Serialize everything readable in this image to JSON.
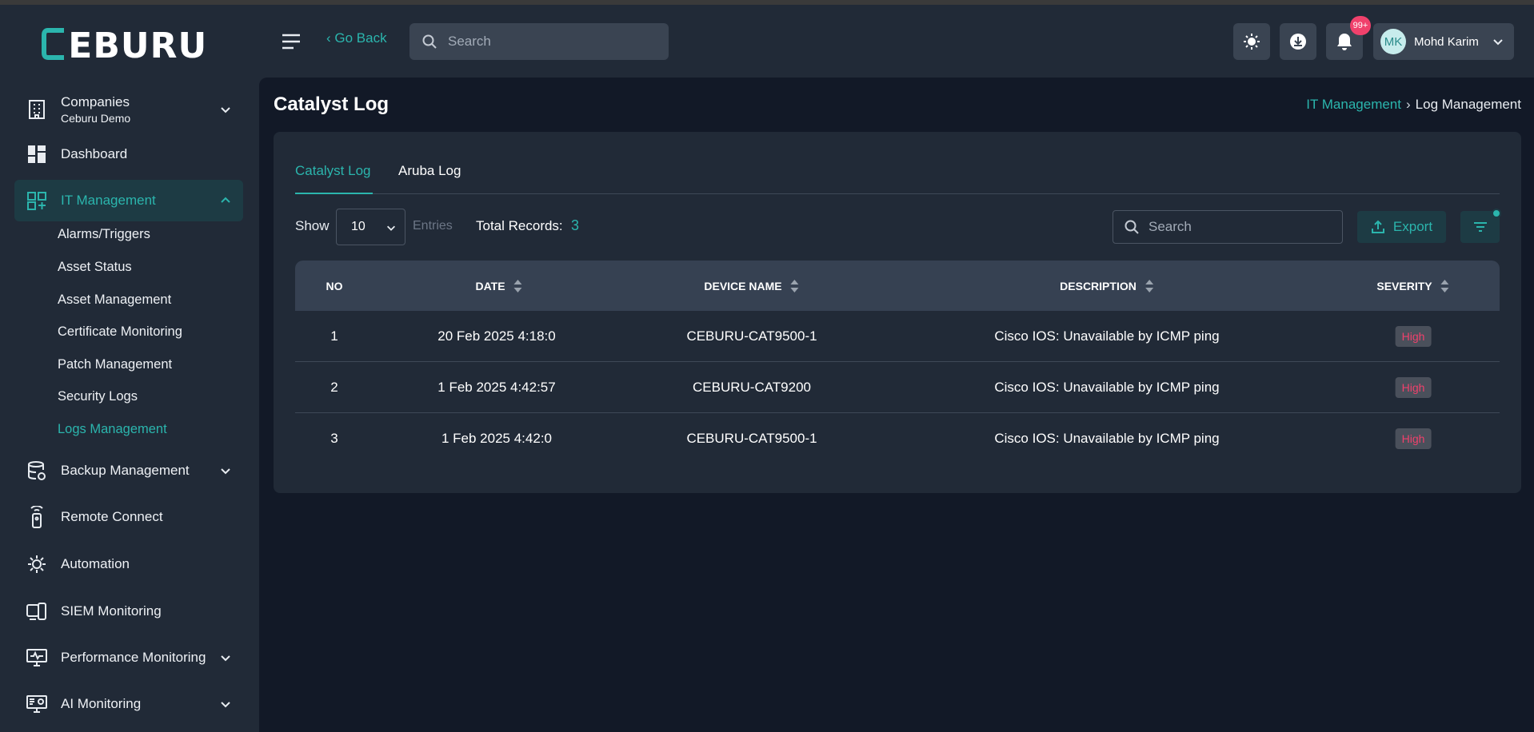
{
  "app": {
    "logo_text": "CEBURU",
    "go_back": "Go Back",
    "search_placeholder": "Search",
    "notification_badge": "99+",
    "user": {
      "initials": "MK",
      "name": "Mohd Karim"
    }
  },
  "sidebar": {
    "companies": {
      "label": "Companies",
      "sub": "Ceburu Demo"
    },
    "items": [
      {
        "label": "Dashboard",
        "icon": "dashboard-icon"
      },
      {
        "label": "IT Management",
        "icon": "it-management-icon",
        "active": true
      },
      {
        "label": "Backup Management",
        "icon": "database-icon"
      },
      {
        "label": "Remote Connect",
        "icon": "remote-icon"
      },
      {
        "label": "Automation",
        "icon": "automation-icon"
      },
      {
        "label": "SIEM Monitoring",
        "icon": "siem-icon"
      },
      {
        "label": "Performance Monitoring",
        "icon": "monitor-icon"
      },
      {
        "label": "AI Monitoring",
        "icon": "ai-monitor-icon"
      }
    ],
    "sub_items": [
      "Alarms/Triggers",
      "Asset Status",
      "Asset Management",
      "Certificate Monitoring",
      "Patch Management",
      "Security Logs",
      "Logs Management"
    ]
  },
  "page": {
    "title": "Catalyst Log",
    "breadcrumb": [
      "IT Management",
      "Log Management"
    ]
  },
  "tabs": [
    "Catalyst Log",
    "Aruba Log"
  ],
  "controls": {
    "show_label": "Show",
    "entries_value": "10",
    "entries_label": "Entries",
    "total_label": "Total Records:",
    "total_value": "3",
    "search_placeholder": "Search",
    "export_label": "Export"
  },
  "table": {
    "columns": [
      "NO",
      "DATE",
      "DEVICE NAME",
      "DESCRIPTION",
      "SEVERITY"
    ],
    "rows": [
      {
        "no": "1",
        "date": "20 Feb 2025 4:18:0",
        "device": "CEBURU-CAT9500-1",
        "description": "Cisco IOS: Unavailable by ICMP ping",
        "severity": "High"
      },
      {
        "no": "2",
        "date": "1 Feb 2025 4:42:57",
        "device": "CEBURU-CAT9200",
        "description": "Cisco IOS: Unavailable by ICMP ping",
        "severity": "High"
      },
      {
        "no": "3",
        "date": "1 Feb 2025 4:42:0",
        "device": "CEBURU-CAT9500-1",
        "description": "Cisco IOS: Unavailable by ICMP ping",
        "severity": "High"
      }
    ]
  },
  "colors": {
    "accent": "#2bb5ad",
    "danger": "#f0416c",
    "sidebar_bg": "#212a37",
    "main_bg": "#121927"
  }
}
